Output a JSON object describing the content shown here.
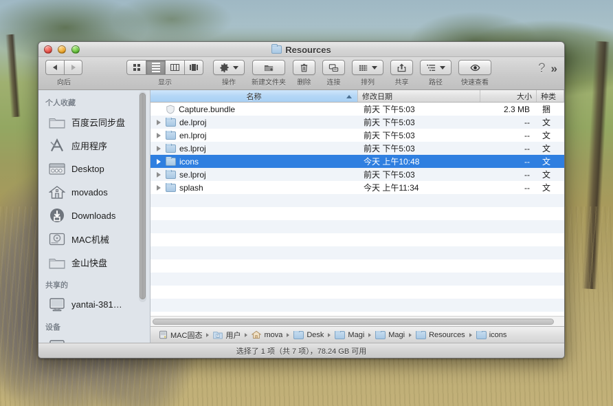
{
  "window": {
    "title": "Resources",
    "title_icon": "folder-icon",
    "controls": {
      "close": "close-button",
      "minimize": "minimize-button",
      "zoom": "zoom-button"
    }
  },
  "toolbar": {
    "nav": {
      "back_label": "向后",
      "back_icon": "arrow-left-icon",
      "forward_icon": "arrow-right-icon"
    },
    "view": {
      "label": "显示",
      "modes": [
        {
          "name": "icon-view",
          "icon": "grid-icon",
          "active": false
        },
        {
          "name": "list-view",
          "icon": "list-icon",
          "active": true
        },
        {
          "name": "column-view",
          "icon": "columns-icon",
          "active": false
        },
        {
          "name": "coverflow-view",
          "icon": "coverflow-icon",
          "active": false
        }
      ]
    },
    "items": [
      {
        "label": "操作",
        "icon": "gear-icon",
        "has_caret": true
      },
      {
        "label": "新建文件夹",
        "icon": "new-folder-icon",
        "has_caret": false
      },
      {
        "label": "删除",
        "icon": "trash-icon",
        "has_caret": false
      },
      {
        "label": "连接",
        "icon": "connect-icon",
        "has_caret": false
      },
      {
        "label": "排列",
        "icon": "arrange-icon",
        "has_caret": true
      },
      {
        "label": "共享",
        "icon": "share-icon",
        "has_caret": false
      },
      {
        "label": "路径",
        "icon": "path-icon",
        "has_caret": true
      },
      {
        "label": "快速查看",
        "icon": "eye-icon",
        "has_caret": false
      }
    ],
    "help_glyph": "?",
    "overflow_glyph": "»"
  },
  "sidebar": {
    "sections": [
      {
        "header": "个人收藏",
        "items": [
          {
            "label": "百度云同步盘",
            "icon": "folder-icon"
          },
          {
            "label": "应用程序",
            "icon": "applications-icon"
          },
          {
            "label": "Desktop",
            "icon": "desktop-icon"
          },
          {
            "label": "movados",
            "icon": "home-icon"
          },
          {
            "label": "Downloads",
            "icon": "downloads-icon"
          },
          {
            "label": "MAC机械",
            "icon": "harddisk-icon"
          },
          {
            "label": "金山快盘",
            "icon": "folder-icon"
          }
        ]
      },
      {
        "header": "共享的",
        "items": [
          {
            "label": "yantai-381…",
            "icon": "display-icon"
          }
        ]
      },
      {
        "header": "设备",
        "items": [
          {
            "label": "",
            "icon": "display-icon"
          }
        ]
      }
    ]
  },
  "file_list": {
    "columns": [
      {
        "label": "名称",
        "key": "name",
        "sorted": true,
        "sort_dir": "asc"
      },
      {
        "label": "修改日期",
        "key": "date",
        "sorted": false
      },
      {
        "label": "大小",
        "key": "size",
        "sorted": false
      },
      {
        "label": "种类",
        "key": "kind",
        "sorted": false
      }
    ],
    "rows": [
      {
        "name": "Capture.bundle",
        "date": "前天 下午5:03",
        "size": "2.3 MB",
        "kind": "捆",
        "icon": "bundle-icon",
        "expandable": false,
        "selected": false
      },
      {
        "name": "de.lproj",
        "date": "前天 下午5:03",
        "size": "--",
        "kind": "文",
        "icon": "folder-icon",
        "expandable": true,
        "selected": false
      },
      {
        "name": "en.lproj",
        "date": "前天 下午5:03",
        "size": "--",
        "kind": "文",
        "icon": "folder-icon",
        "expandable": true,
        "selected": false
      },
      {
        "name": "es.lproj",
        "date": "前天 下午5:03",
        "size": "--",
        "kind": "文",
        "icon": "folder-icon",
        "expandable": true,
        "selected": false
      },
      {
        "name": "icons",
        "date": "今天 上午10:48",
        "size": "--",
        "kind": "文",
        "icon": "folder-icon",
        "expandable": true,
        "selected": true
      },
      {
        "name": "se.lproj",
        "date": "前天 下午5:03",
        "size": "--",
        "kind": "文",
        "icon": "folder-icon",
        "expandable": true,
        "selected": false
      },
      {
        "name": "splash",
        "date": "今天 上午11:34",
        "size": "--",
        "kind": "文",
        "icon": "folder-icon",
        "expandable": true,
        "selected": false
      }
    ]
  },
  "pathbar": {
    "crumbs": [
      {
        "label": "MAC固态",
        "icon": "harddisk-icon"
      },
      {
        "label": "用户",
        "icon": "users-folder-icon"
      },
      {
        "label": "mova",
        "icon": "home-icon"
      },
      {
        "label": "Desk",
        "icon": "folder-icon"
      },
      {
        "label": "Magi",
        "icon": "folder-icon"
      },
      {
        "label": "Magi",
        "icon": "folder-icon"
      },
      {
        "label": "Resources",
        "icon": "folder-icon"
      },
      {
        "label": "icons",
        "icon": "folder-icon"
      }
    ]
  },
  "statusbar": {
    "text": "选择了 1 项（共 7 项），78.24 GB 可用"
  },
  "colors": {
    "selection_blue": "#2f7fe0",
    "sorted_header_blue": "#b4d7f6",
    "sidebar_bg": "#dfe4ea",
    "row_stripe": "#f0f4f9"
  }
}
